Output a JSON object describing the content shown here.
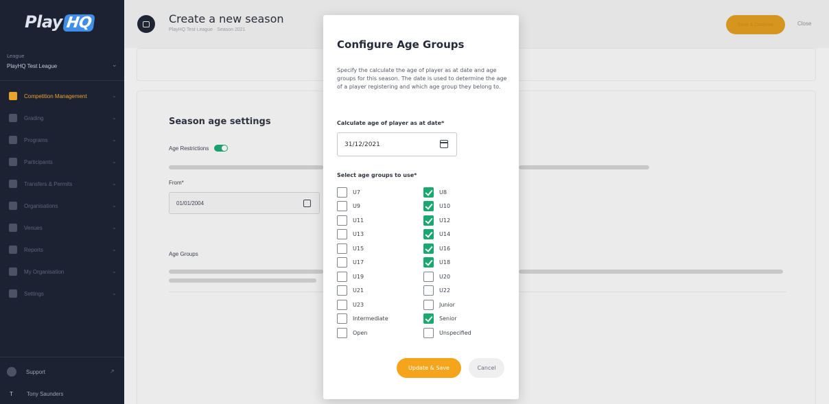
{
  "sidebar": {
    "logo": "Play",
    "logo_badge": "HQ",
    "league_label": "League",
    "league_name": "PlayHQ Test League",
    "nav": [
      {
        "label": "Competition Management",
        "active": true
      },
      {
        "label": "Grading",
        "active": false
      },
      {
        "label": "Programs",
        "active": false
      },
      {
        "label": "Participants",
        "active": false
      },
      {
        "label": "Transfers & Permits",
        "active": false
      },
      {
        "label": "Organisations",
        "active": false
      },
      {
        "label": "Venues",
        "active": false
      },
      {
        "label": "Reports",
        "active": false
      },
      {
        "label": "My Organisation",
        "active": false
      },
      {
        "label": "Settings",
        "active": false
      }
    ],
    "support": "Support",
    "user_initial": "T",
    "user_name": "Tony Saunders"
  },
  "header": {
    "title": "Create a new season",
    "subtitle": "PlayHQ Test League · Season 2021",
    "save_button": "Save & Continue",
    "close_button": "Close"
  },
  "page": {
    "section_title": "Season age settings",
    "age_restrictions_label": "Age Restrictions",
    "age_restrictions_on": true,
    "from_label": "From*",
    "from_value": "01/01/2004",
    "age_groups_label": "Age Groups"
  },
  "modal": {
    "title": "Configure Age Groups",
    "description": "Specify the calculate the age of player as at date and age groups for this season. The date is used to determine the age of a player registering and which age group they belong to.",
    "date_label": "Calculate age of player as at date*",
    "date_value": "31/12/2021",
    "groups_label": "Select age groups to use*",
    "groups_left": [
      {
        "label": "U7",
        "checked": false
      },
      {
        "label": "U9",
        "checked": false
      },
      {
        "label": "U11",
        "checked": false
      },
      {
        "label": "U13",
        "checked": false
      },
      {
        "label": "U15",
        "checked": false
      },
      {
        "label": "U17",
        "checked": false
      },
      {
        "label": "U19",
        "checked": false
      },
      {
        "label": "U21",
        "checked": false
      },
      {
        "label": "U23",
        "checked": false
      },
      {
        "label": "Intermediate",
        "checked": false
      },
      {
        "label": "Open",
        "checked": false
      }
    ],
    "groups_right": [
      {
        "label": "U8",
        "checked": true
      },
      {
        "label": "U10",
        "checked": true
      },
      {
        "label": "U12",
        "checked": true
      },
      {
        "label": "U14",
        "checked": true
      },
      {
        "label": "U16",
        "checked": true
      },
      {
        "label": "U18",
        "checked": true
      },
      {
        "label": "U20",
        "checked": false
      },
      {
        "label": "U22",
        "checked": false
      },
      {
        "label": "Junior",
        "checked": false
      },
      {
        "label": "Senior",
        "checked": true
      },
      {
        "label": "Unspecified",
        "checked": false
      }
    ],
    "update_button": "Update & Save",
    "cancel_button": "Cancel"
  },
  "colors": {
    "sidebar_bg": "#1d2233",
    "accent": "#f5a51c",
    "check_green": "#19a86f"
  }
}
